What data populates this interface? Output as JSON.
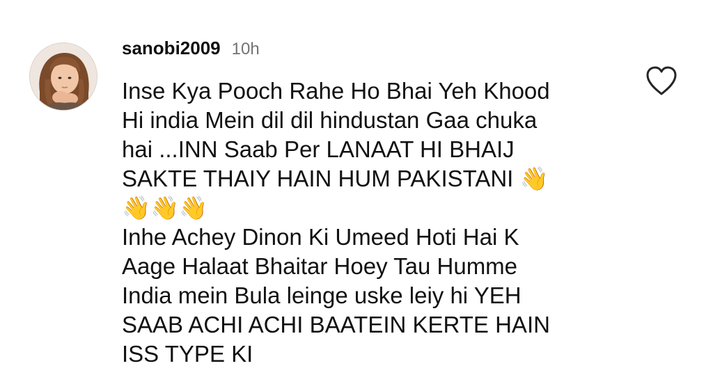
{
  "comment": {
    "username": "sanobi2009",
    "timestamp": "10h",
    "text": "Inse Kya Pooch Rahe Ho Bhai Yeh Khood\nHi india Mein dil dil hindustan Gaa chuka\nhai ...INN Saab Per LANAAT HI BHAIJ\nSAKTE THAIY HAIN HUM PAKISTANI 👋\n👋👋👋\nInhe Achey Dinon Ki Umeed Hoti Hai K\nAage Halaat Bhaitar Hoey Tau Humme\nIndia mein Bula leinge uske leiy hi YEH\nSAAB ACHI ACHI BAATEIN KERTE HAIN\nISS TYPE KI",
    "avatar_icon": "profile-photo",
    "like_icon": "heart-outline-icon"
  },
  "colors": {
    "text": "#111111",
    "muted": "#737373",
    "background": "#ffffff"
  }
}
